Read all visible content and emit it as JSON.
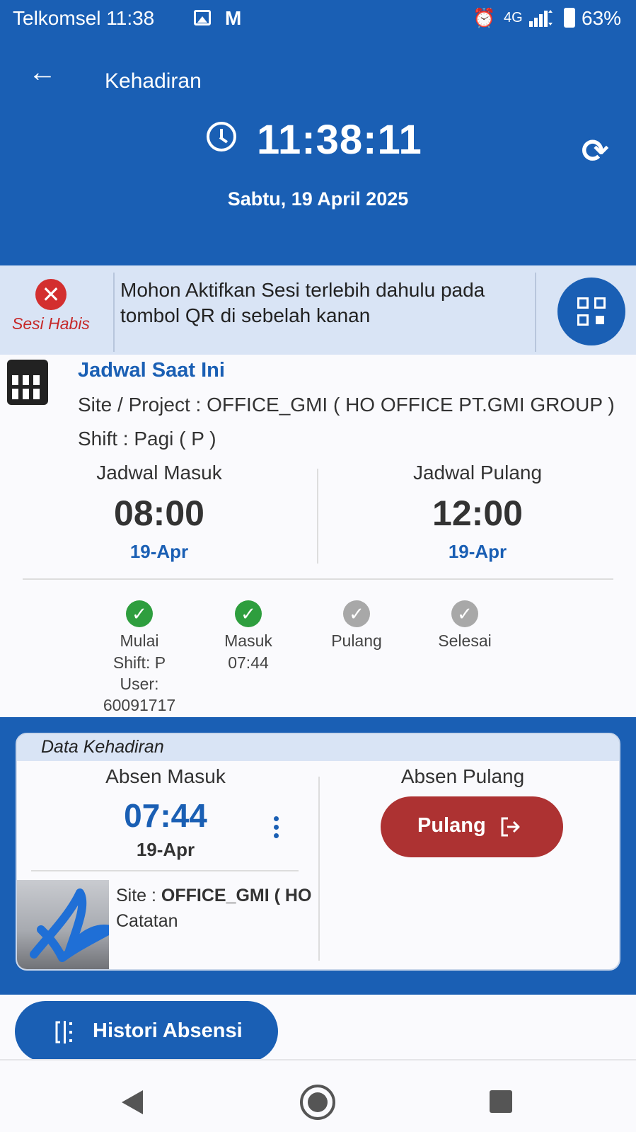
{
  "status_bar": {
    "carrier_time": "Telkomsel 11:38",
    "gmail_glyph": "M",
    "network": "4G",
    "battery": "63%"
  },
  "header": {
    "title": "Kehadiran",
    "time": "11:38:11",
    "date": "Sabtu, 19 April 2025",
    "color": "#1a5fb4"
  },
  "session": {
    "status": "Sesi Habis",
    "message": "Mohon Aktifkan Sesi terlebih dahulu pada tombol QR di sebelah kanan"
  },
  "schedule": {
    "title": "Jadwal Saat Ini",
    "site": "Site / Project :  OFFICE_GMI ( HO OFFICE PT.GMI GROUP )",
    "shift": "Shift :  Pagi ( P )",
    "in": {
      "label": "Jadwal Masuk",
      "time": "08:00",
      "date": "19-Apr"
    },
    "out": {
      "label": "Jadwal Pulang",
      "time": "12:00",
      "date": "19-Apr"
    }
  },
  "steps": [
    {
      "label": "Mulai",
      "sub1": "Shift: P",
      "sub2": "User:",
      "sub3": "60091717",
      "done": true
    },
    {
      "label": "Masuk",
      "sub1": "07:44",
      "done": true
    },
    {
      "label": "Pulang",
      "done": false
    },
    {
      "label": "Selesai",
      "done": false
    }
  ],
  "attendance": {
    "title": "Data Kehadiran",
    "in_label": "Absen Masuk",
    "in_time": "07:44",
    "in_date": "19-Apr",
    "site_prefix": "Site :  ",
    "site_value": "OFFICE_GMI ( HO",
    "note": "Catatan",
    "out_label": "Absen Pulang",
    "out_button": "Pulang",
    "button_color": "#ad3232"
  },
  "history_button": "Histori Absensi"
}
